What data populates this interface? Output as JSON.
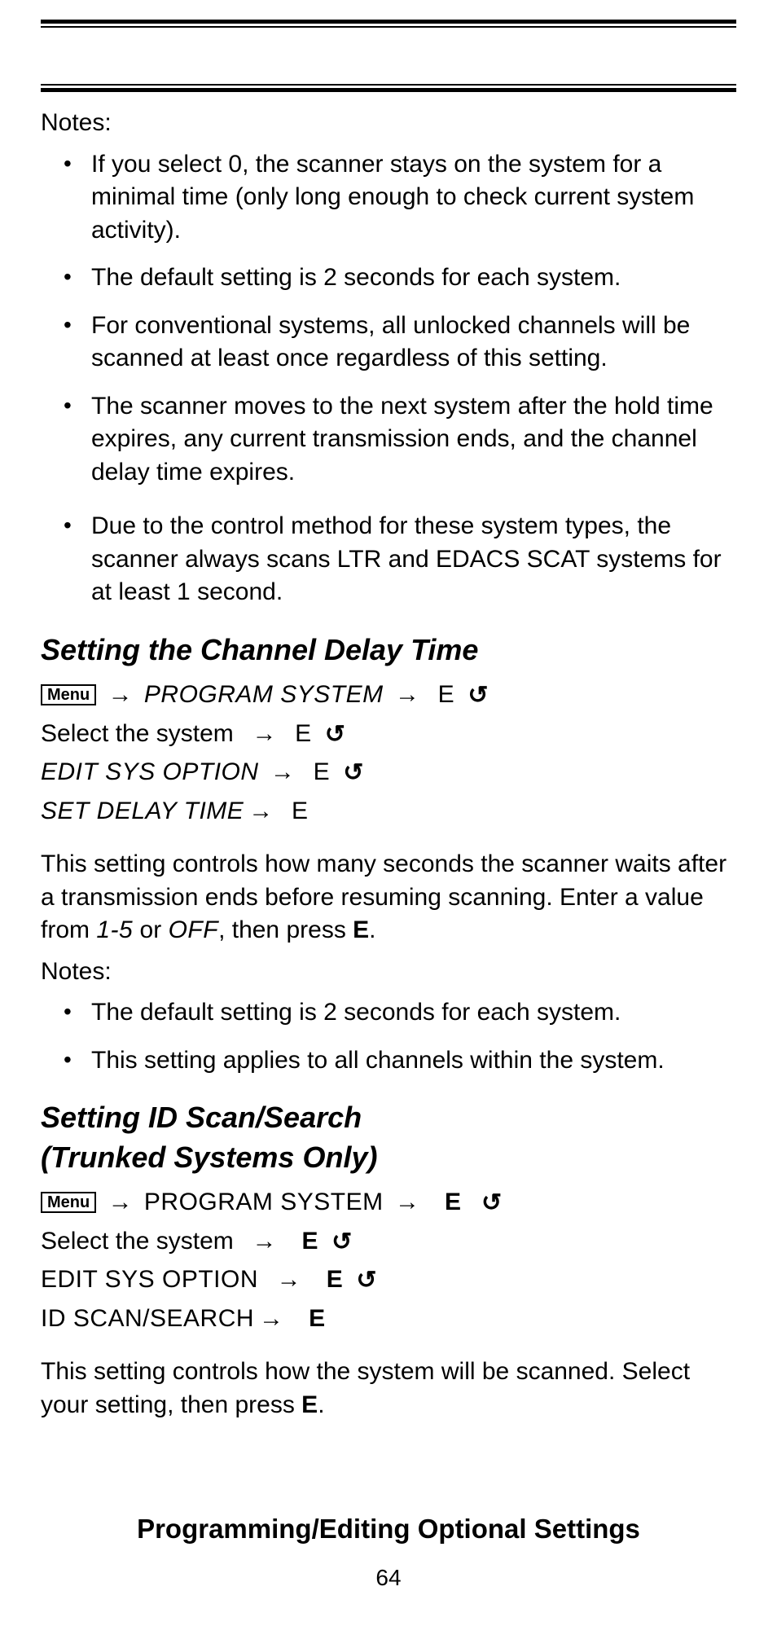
{
  "notes1": {
    "label": "Notes:",
    "items": [
      "If you select 0, the scanner stays on the system for a minimal time (only long enough to check current system activity).",
      "The default setting is 2 seconds for each system.",
      "For conventional systems, all unlocked channels will be scanned at least once regardless of this setting.",
      "The scanner moves to the next system after the hold time expires, any current transmission ends, and the channel delay time expires.",
      "Due to the control method for these system types, the scanner always scans LTR and EDACS SCAT sys­tems for at least 1 second."
    ]
  },
  "sectionA": {
    "title": "Setting the Channel Delay Time",
    "menu": "Menu",
    "step1": "PROGRAM SYSTEM",
    "e": "E",
    "select_system": "Select the system",
    "edit_sys_option": "EDIT SYS OPTION",
    "set_delay_time": "SET DELAY TIME",
    "para_pre": "This setting controls how many seconds the scanner waits after a transmission ends before resuming scanning. Enter a value from ",
    "range": "1-5",
    "or": " or ",
    "off": "OFF",
    "para_post": ", then press ",
    "para_end": "."
  },
  "notes2": {
    "label": "Notes:",
    "items": [
      "The default setting is 2 seconds for each system.",
      "This setting applies to all channels within the system."
    ]
  },
  "sectionB": {
    "title_l1": "Setting ID Scan/Search",
    "title_l2": "(Trunked Systems Only)",
    "menu": "Menu",
    "step1": "PROGRAM SYSTEM",
    "e": "E",
    "select_system": "Select the system",
    "edit_sys_option": "EDIT SYS OPTION",
    "id_scan_search": "ID SCAN/SEARCH",
    "para_pre": "This setting controls how the system will be scanned. Select your setting, then press ",
    "para_end": "."
  },
  "footer": {
    "title": "Programming/Editing Optional Settings",
    "page": "64"
  },
  "glyph": {
    "arrow": "→",
    "rotate": "↺"
  }
}
